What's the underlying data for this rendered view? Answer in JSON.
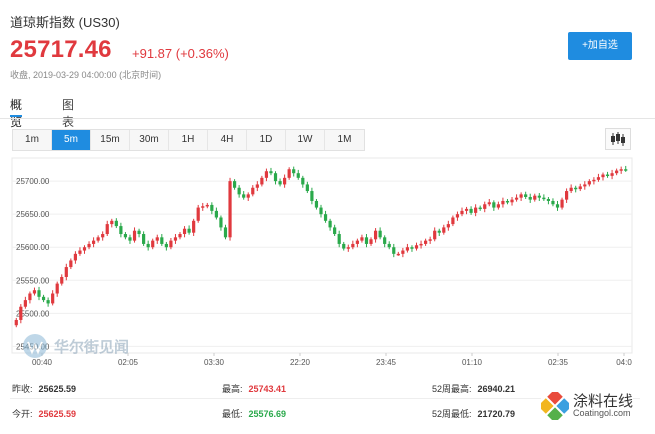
{
  "header": {
    "title": "道琼斯指数 (US30)",
    "price": "25717.46",
    "change": "+91.87 (+0.36%)",
    "close_time": "收盘, 2019-03-29 04:00:00 (北京时间)",
    "watch_button": "+加自选"
  },
  "tabs": [
    "概览",
    "图表"
  ],
  "periods": [
    "1m",
    "5m",
    "15m",
    "30m",
    "1H",
    "4H",
    "1D",
    "1W",
    "1M"
  ],
  "active_period": "5m",
  "icons": {
    "chart_type": "candlestick-icon"
  },
  "colors": {
    "up": "#e0393e",
    "down": "#2aa94b",
    "accent": "#1f8ce0"
  },
  "chart_data": {
    "type": "candlestick",
    "y_ticks": [
      "25700.00",
      "25650.00",
      "25600.00",
      "25550.00",
      "25500.00",
      "25450.00"
    ],
    "x_ticks": [
      "00:40",
      "02:05",
      "03:30",
      "22:20",
      "23:45",
      "01:10",
      "02:35",
      "04:0"
    ],
    "ylim": [
      25440,
      25735
    ],
    "closes": [
      25490,
      25510,
      25520,
      25530,
      25535,
      25525,
      25520,
      25515,
      25530,
      25545,
      25555,
      25570,
      25580,
      25590,
      25595,
      25600,
      25605,
      25610,
      25615,
      25620,
      25635,
      25640,
      25632,
      25620,
      25615,
      25610,
      25625,
      25620,
      25605,
      25600,
      25610,
      25615,
      25605,
      25600,
      25610,
      25615,
      25620,
      25628,
      25622,
      25640,
      25660,
      25662,
      25664,
      25655,
      25645,
      25630,
      25615,
      25700,
      25690,
      25680,
      25675,
      25680,
      25690,
      25695,
      25705,
      25715,
      25712,
      25700,
      25695,
      25705,
      25718,
      25712,
      25705,
      25695,
      25685,
      25670,
      25660,
      25650,
      25640,
      25630,
      25620,
      25605,
      25598,
      25600,
      25605,
      25610,
      25615,
      25605,
      25612,
      25625,
      25615,
      25605,
      25600,
      25590,
      25590,
      25595,
      25600,
      25598,
      25603,
      25605,
      25610,
      25612,
      25625,
      25622,
      25630,
      25635,
      25645,
      25650,
      25655,
      25658,
      25652,
      25660,
      25658,
      25665,
      25668,
      25660,
      25665,
      25670,
      25668,
      25672,
      25675,
      25680,
      25676,
      25672,
      25678,
      25675,
      25673,
      25670,
      25665,
      25660,
      25672,
      25685,
      25690,
      25688,
      25692,
      25695,
      25700,
      25702,
      25706,
      25710,
      25708,
      25712,
      25716,
      25718,
      25717
    ],
    "grid": "horizontal"
  },
  "stats": {
    "prev_close_label": "昨收:",
    "prev_close": "25625.59",
    "high_label": "最高:",
    "high": "25743.41",
    "high52_label": "52周最高:",
    "high52": "26940.21",
    "open_label": "今开:",
    "open": "25625.59",
    "low_label": "最低:",
    "low": "25576.69",
    "low52_label": "52周最低:",
    "low52": "21720.79"
  },
  "watermarks": {
    "wallstreet": "华尔街见闻",
    "site_name": "涂料在线",
    "site_url": "Coatingol.com"
  }
}
